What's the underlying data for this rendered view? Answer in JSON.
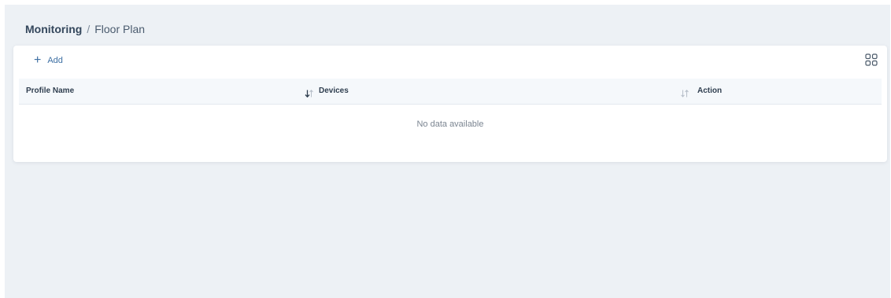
{
  "breadcrumb": {
    "root": "Monitoring",
    "separator": "/",
    "current": "Floor Plan"
  },
  "toolbar": {
    "add_label": "Add",
    "add_icon": "plus-icon",
    "view_icon": "grid-view-icon"
  },
  "table": {
    "columns": [
      {
        "label": "Profile Name",
        "sort_icon": "sort-desc-icon"
      },
      {
        "label": "Devices",
        "sort_icon": "sort-neutral-icon"
      },
      {
        "label": "Action"
      }
    ],
    "empty_message": "No data available"
  },
  "colors": {
    "background": "#edf1f5",
    "card": "#ffffff",
    "accent": "#3d6fa3",
    "header_row": "#f5f8fb"
  }
}
